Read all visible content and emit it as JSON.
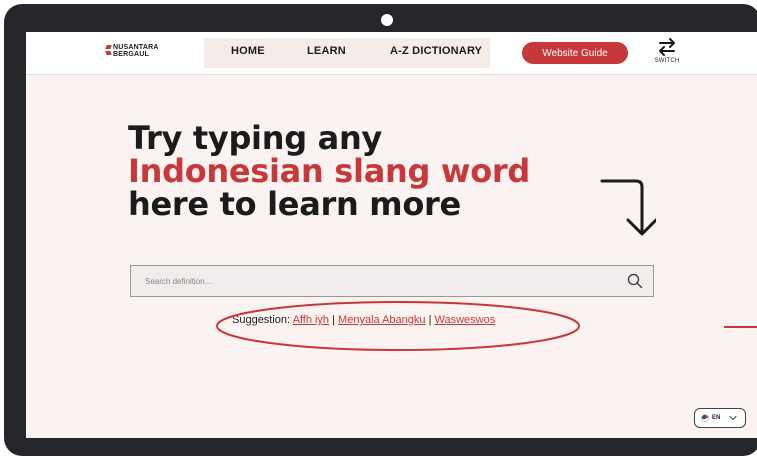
{
  "colors": {
    "brand_red": "#c8383a",
    "frame": "#242629",
    "page_bg": "#faf3f1",
    "text_dark": "#1b1b1b"
  },
  "logo": {
    "line1": "NUSANTARA",
    "line2": "BERGAUL",
    "icon": "nusantara-logo-icon"
  },
  "nav": {
    "home": "HOME",
    "learn": "LEARN",
    "dictionary": "A-Z DICTIONARY",
    "guide_button": "Website Guide",
    "switch_label": "SWITCH",
    "switch_icon": "swap-arrows-icon"
  },
  "hero": {
    "line1": "Try typing any",
    "line2": "Indonesian slang word",
    "line3": "here to learn more",
    "arrow_icon": "curved-down-arrow-icon"
  },
  "search": {
    "placeholder": "Search definition...",
    "value": "",
    "icon": "search-icon"
  },
  "suggestion": {
    "label": "Suggestion:",
    "items": [
      "Affh iyh",
      "Menyala Abangku",
      "Wasweswos"
    ],
    "separator": "|"
  },
  "language": {
    "code": "EN",
    "flag_icon": "us-flag-icon",
    "chevron_icon": "chevron-down-icon"
  }
}
